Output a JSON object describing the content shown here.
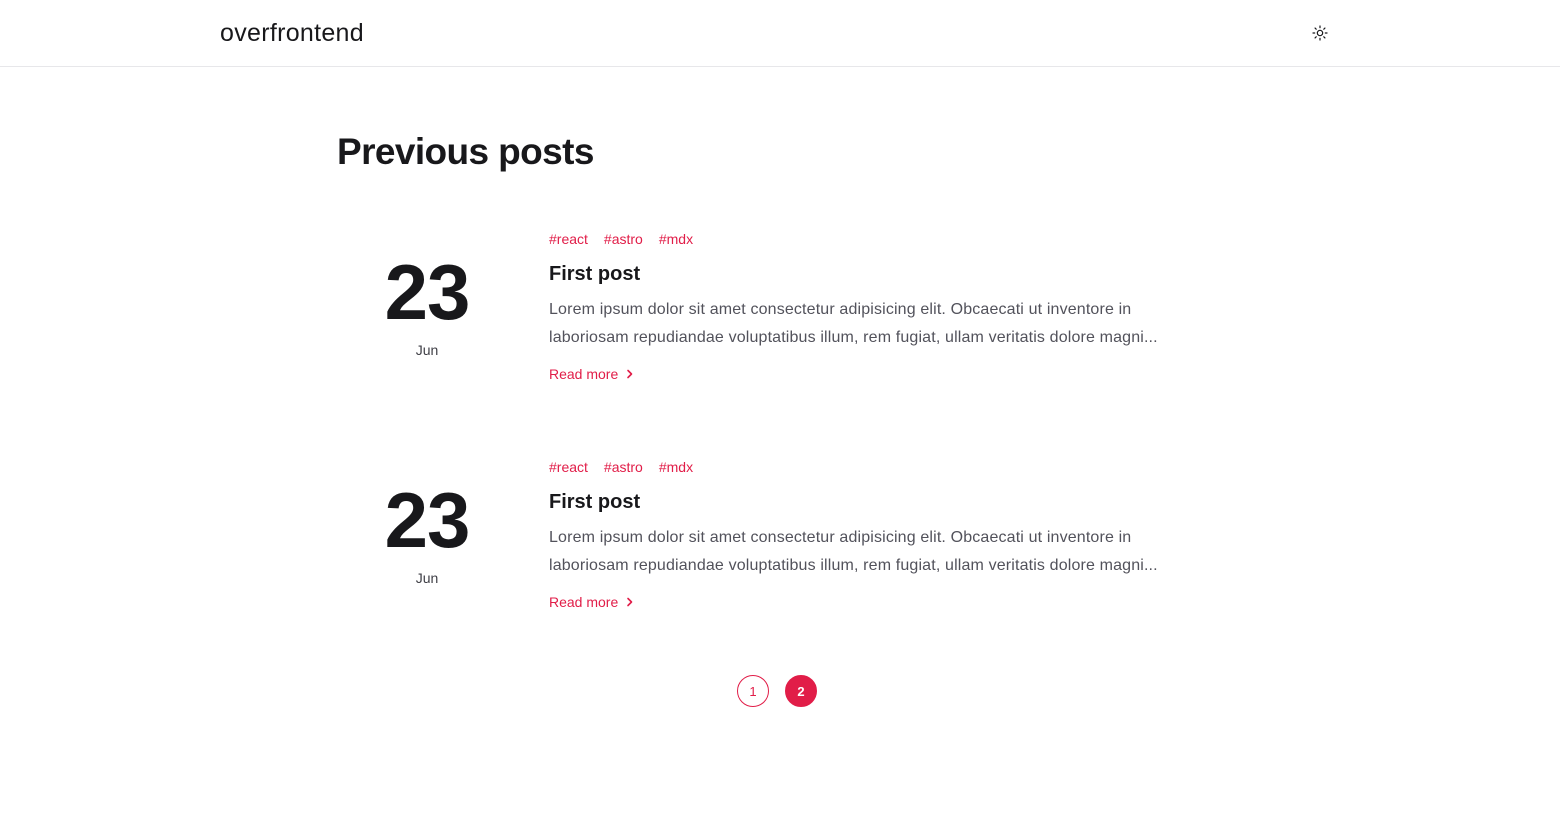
{
  "header": {
    "brand": "overfrontend",
    "theme_icon": "sun-icon"
  },
  "main": {
    "title": "Previous posts",
    "posts": [
      {
        "day": "23",
        "month": "Jun",
        "tags": [
          "#react",
          "#astro",
          "#mdx"
        ],
        "title": "First post",
        "excerpt": "Lorem ipsum dolor sit amet consectetur adipisicing elit. Obcaecati ut inventore in laboriosam repudiandae voluptatibus illum, rem fugiat, ullam veritatis dolore magni...",
        "read_more": "Read more"
      },
      {
        "day": "23",
        "month": "Jun",
        "tags": [
          "#react",
          "#astro",
          "#mdx"
        ],
        "title": "First post",
        "excerpt": "Lorem ipsum dolor sit amet consectetur adipisicing elit. Obcaecati ut inventore in laboriosam repudiandae voluptatibus illum, rem fugiat, ullam veritatis dolore magni...",
        "read_more": "Read more"
      }
    ]
  },
  "pagination": {
    "pages": [
      "1",
      "2"
    ],
    "current": "2"
  },
  "colors": {
    "accent": "#e11d48",
    "text": "#18181b",
    "muted": "#52525b",
    "border": "#e7e7ea"
  }
}
